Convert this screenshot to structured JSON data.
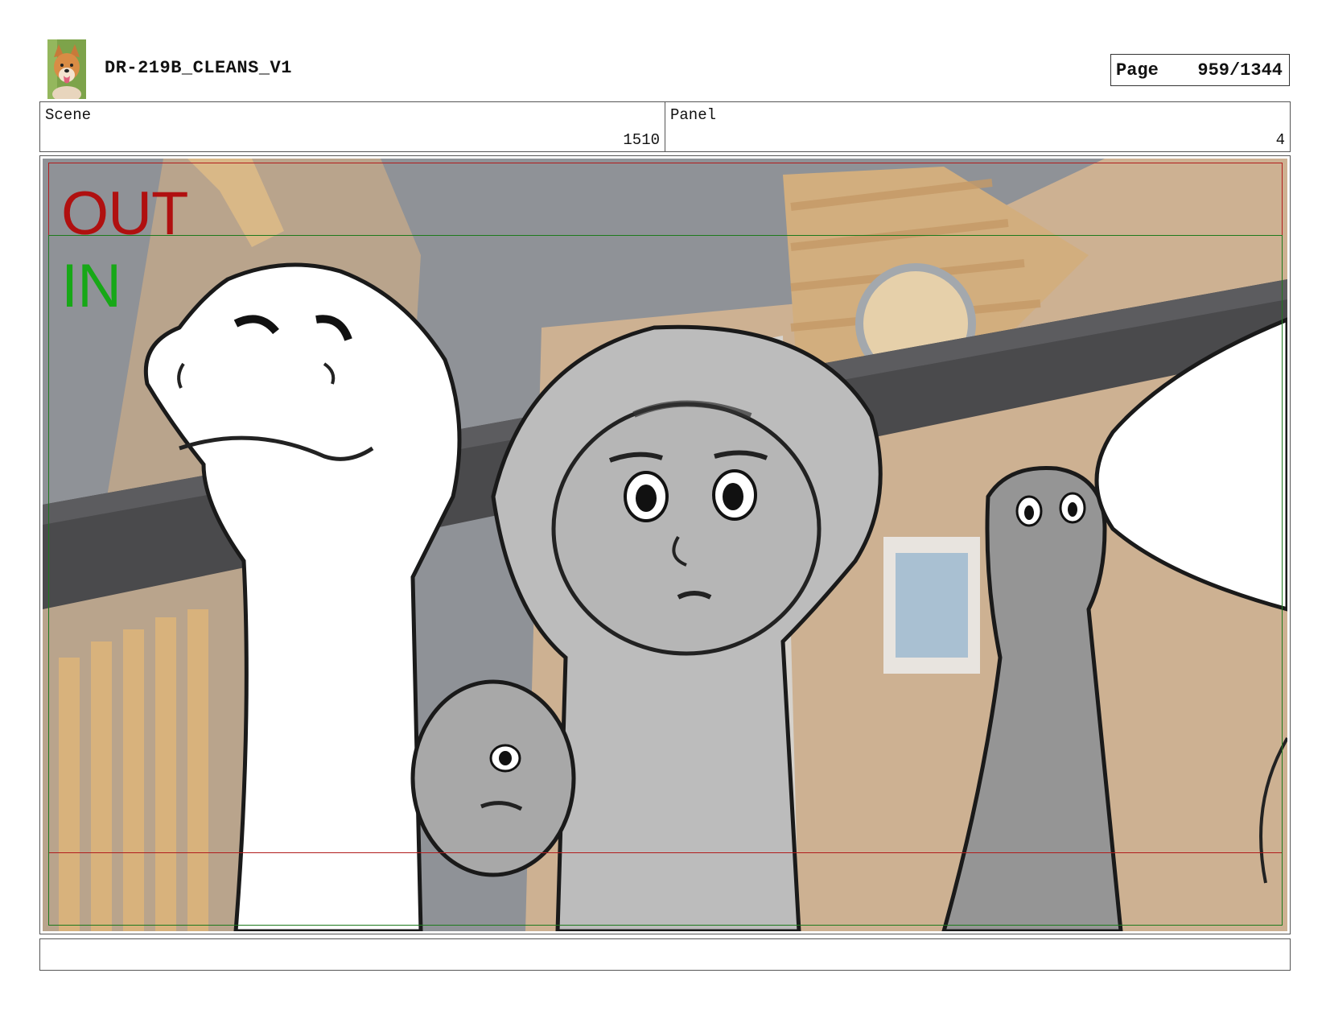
{
  "header": {
    "title": "DR-219B_CLEANS_V1",
    "page_label": "Page",
    "page_number": "959/1344",
    "logo_icon": "dog-logo-icon"
  },
  "info": {
    "scene_label": "Scene",
    "scene_value": "1510",
    "panel_label": "Panel",
    "panel_value": "4"
  },
  "panel": {
    "safe_out_label": "OUT",
    "safe_in_label": "IN",
    "out_color": "#b01010",
    "in_color": "#17a817"
  },
  "notes": {
    "text": ""
  }
}
